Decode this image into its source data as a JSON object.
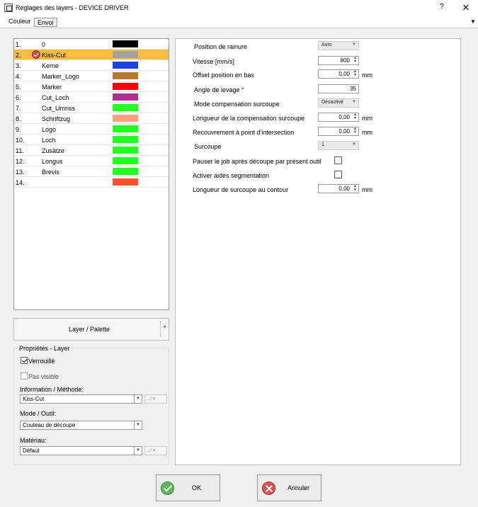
{
  "window": {
    "title": "Réglages des layers - DEVICE DRIVER",
    "help_glyph": "?",
    "close_glyph": "✕"
  },
  "tabs": [
    {
      "label": "Couleur"
    },
    {
      "label": "Envoi",
      "active": true
    }
  ],
  "layers": [
    {
      "num": "1.",
      "name": "0",
      "color": "#000000"
    },
    {
      "num": "2.",
      "name": "Kiss-Cut",
      "color": "#a0a0a0",
      "selected": true,
      "checked": true
    },
    {
      "num": "3.",
      "name": "Kerne",
      "color": "#2040e0"
    },
    {
      "num": "4.",
      "name": "Marker_Logo",
      "color": "#b87830"
    },
    {
      "num": "5.",
      "name": "Marker",
      "color": "#ff0000"
    },
    {
      "num": "6.",
      "name": "Cut_Loch",
      "color": "#b03090"
    },
    {
      "num": "7.",
      "name": "Cut_Umriss",
      "color": "#20ff20"
    },
    {
      "num": "8.",
      "name": "Schriftzug",
      "color": "#f8a080"
    },
    {
      "num": "9.",
      "name": "Logo",
      "color": "#20ff20"
    },
    {
      "num": "10.",
      "name": "Loch",
      "color": "#20ff20"
    },
    {
      "num": "11.",
      "name": "Zusätze",
      "color": "#20ff20"
    },
    {
      "num": "12.",
      "name": "Longus",
      "color": "#20ff20"
    },
    {
      "num": "13.",
      "name": "Brevis",
      "color": "#20ff20"
    },
    {
      "num": "14.",
      "name": "",
      "color": "#ff5030"
    }
  ],
  "palette_button": {
    "label": "Layer / Palette"
  },
  "properties": {
    "title": "Propriétés - Layer",
    "locked": {
      "label": "Verrouillé",
      "checked": true
    },
    "not_visible": {
      "label": "Pas visible",
      "checked": false
    },
    "info_method": {
      "label": "Information / Méthode:",
      "value": "Kiss-Cut",
      "extra": "...∕ ▾"
    },
    "mode_tool": {
      "label": "Mode / Outil:",
      "value": "Couteau de découpe"
    },
    "material": {
      "label": "Matériau:",
      "value": "Défaut",
      "extra": "...∕ ▾"
    }
  },
  "settings": {
    "groove_position": {
      "label": "Position de rainure",
      "value": "Auto"
    },
    "speed": {
      "label": "Vitesse [mm/s]",
      "value": "800"
    },
    "offset_bottom": {
      "label": "Offset position en bas",
      "value": "0,00",
      "unit": "mm"
    },
    "lift_angle": {
      "label": "Angle de levage °",
      "value": "35"
    },
    "overcut_comp_mode": {
      "label": "Mode compensation surcoupe",
      "value": "Désactivé"
    },
    "overcut_comp_length": {
      "label": "Longueur de la compensation surcoupe",
      "value": "0,00",
      "unit": "mm"
    },
    "intersection_overlap": {
      "label": "Recouvrement à point d'intersection",
      "value": "0,00",
      "unit": "mm"
    },
    "overcut": {
      "label": "Surcoupe",
      "value": "1"
    },
    "pause_job": {
      "label": "Pauser le job après découpe par présent outil",
      "checked": false
    },
    "segmentation_aids": {
      "label": "Activer aides segmentation",
      "checked": false
    },
    "contour_overcut_length": {
      "label": "Longueur de surcoupe au contour",
      "value": "0,00",
      "unit": "mm"
    }
  },
  "buttons": {
    "ok": "OK",
    "cancel": "Annuler"
  },
  "glyphs": {
    "combo_arrow": "▼",
    "spin_up": "▲",
    "spin_down": "▼",
    "menu_arrow": "▼"
  }
}
